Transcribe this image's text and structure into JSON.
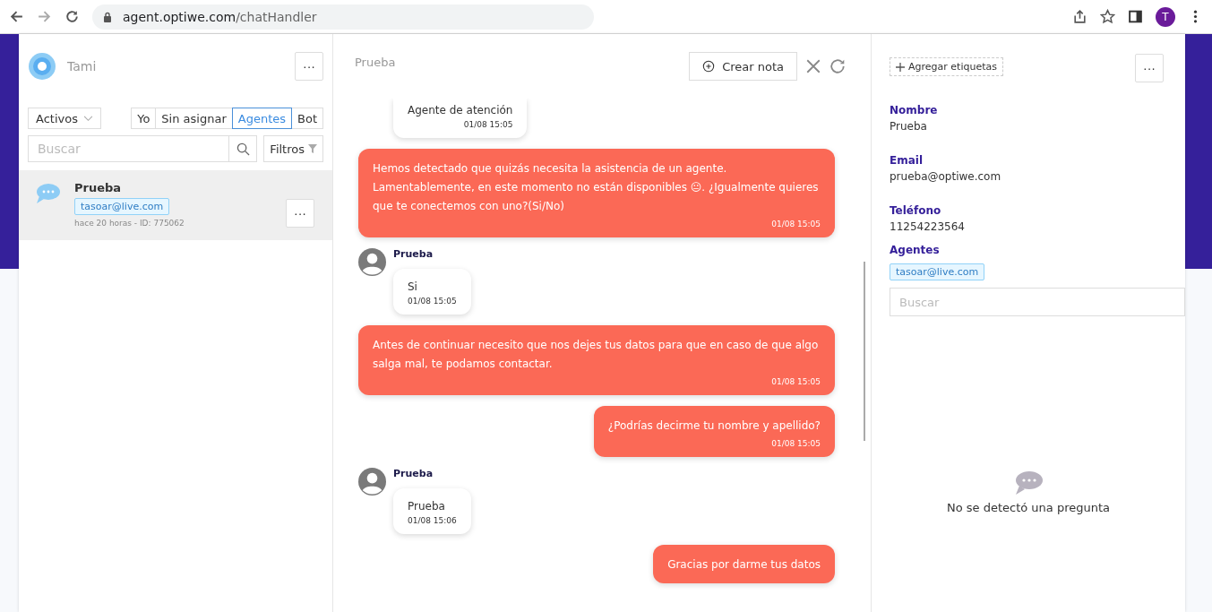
{
  "browser": {
    "url_host": "agent.optiwe.com",
    "url_path": "/chatHandler",
    "profile_initial": "T",
    "forward_disabled": true
  },
  "sidebar": {
    "brand": "Tami",
    "more_label": "···",
    "status_filter": "Activos",
    "segments": [
      {
        "label": "Yo",
        "selected": false
      },
      {
        "label": "Sin asignar",
        "selected": false
      },
      {
        "label": "Agentes",
        "selected": true
      },
      {
        "label": "Bot",
        "selected": false
      }
    ],
    "search": {
      "placeholder": "Buscar"
    },
    "filters_label": "Filtros",
    "conversations": [
      {
        "name": "Prueba",
        "tag": "tasoar@live.com",
        "meta": "hace 20 horas - ID: 775062",
        "selected": true,
        "more_label": "···"
      }
    ]
  },
  "chat": {
    "title": "Prueba",
    "create_note": "Crear nota",
    "messages": [
      {
        "kind": "user",
        "text": "Agente de atención",
        "time": "01/08 15:05"
      },
      {
        "kind": "bot",
        "text": "Hemos detectado que quizás necesita la asistencia de un agente. Lamentablemente, en este momento no están disponibles 😐. ¿Igualmente quieres que te conectemos con uno?(Si/No)",
        "time": "01/08 15:05"
      },
      {
        "kind": "user",
        "sender": "Prueba",
        "text": "Si",
        "time": "01/08 15:05"
      },
      {
        "kind": "bot",
        "text": "Antes de continuar necesito que nos dejes tus datos para que en caso de que algo salga mal, te podamos contactar.",
        "time": "01/08 15:05"
      },
      {
        "kind": "bot",
        "text": "¿Podrías decirme tu nombre y apellido?",
        "time": "01/08 15:05"
      },
      {
        "kind": "user",
        "sender": "Prueba",
        "text": "Prueba",
        "time": "01/08 15:06"
      },
      {
        "kind": "bot",
        "text": "Gracias por darme tus datos"
      }
    ]
  },
  "contact": {
    "add_tags": "Agregar etiquetas",
    "more_label": "···",
    "fields": [
      {
        "label": "Nombre",
        "value": "Prueba"
      },
      {
        "label": "Email",
        "value": "prueba@optiwe.com"
      },
      {
        "label": "Teléfono",
        "value": "11254223564"
      }
    ],
    "agents_label": "Agentes",
    "agents": [
      "tasoar@live.com"
    ],
    "agent_search": {
      "placeholder": "Buscar"
    },
    "empty_state": "No se detectó una pregunta"
  }
}
